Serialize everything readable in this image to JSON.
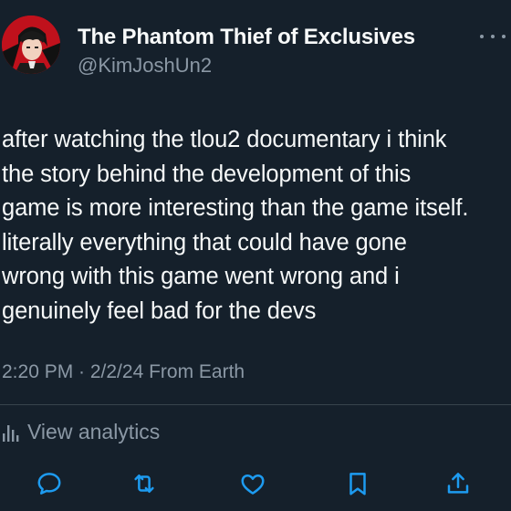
{
  "tweet": {
    "author": {
      "display_name": "The Phantom Thief of Exclusives",
      "handle": "@KimJoshUn2"
    },
    "text_lines": [
      "after watching the tlou2 documentary i think",
      "the story behind the development of this",
      "game is more interesting than the game itself.",
      "literally everything that could have gone",
      "wrong with this game went wrong and i",
      "genuinely feel bad for the devs"
    ],
    "meta": "2:20 PM · 2/2/24 From Earth",
    "analytics_label": "View analytics"
  },
  "icons": {
    "more": "more-icon",
    "analytics": "bar-chart-icon",
    "reply": "reply-icon",
    "retweet": "retweet-icon",
    "like": "heart-icon",
    "bookmark": "bookmark-icon",
    "share": "share-icon"
  },
  "colors": {
    "background": "#15202b",
    "primary_text": "#f7f9f9",
    "secondary_text": "#8b98a5",
    "action_icon": "#1d9bf0",
    "divider": "#38444d"
  }
}
